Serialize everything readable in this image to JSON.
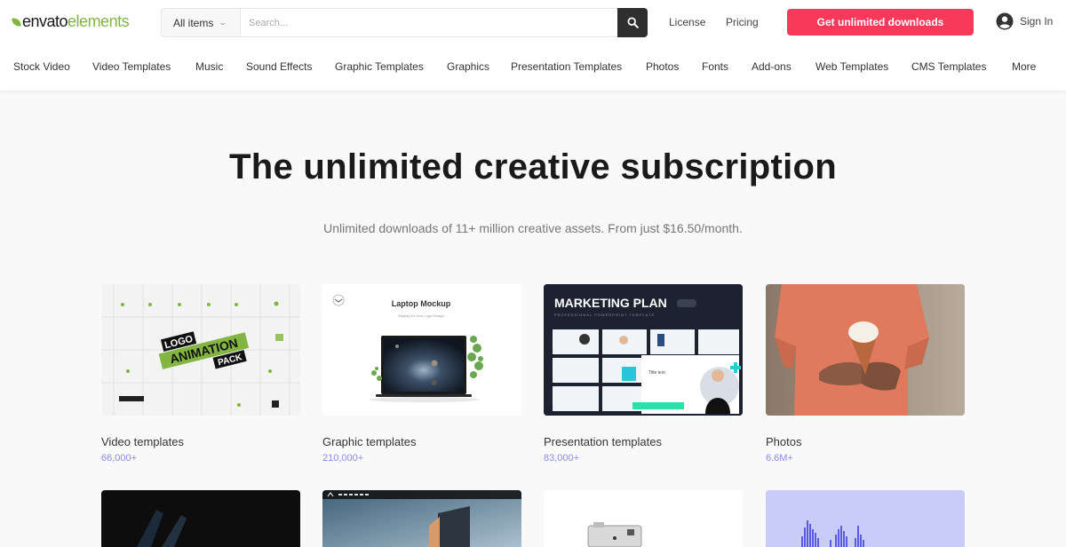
{
  "header": {
    "logo": {
      "brand": "envato",
      "product": "elements"
    },
    "search": {
      "category": "All items",
      "placeholder": "Search..."
    },
    "links": {
      "license": "License",
      "pricing": "Pricing"
    },
    "cta_label": "Get unlimited downloads",
    "signin_label": "Sign In"
  },
  "nav": {
    "items": [
      "Stock Video",
      "Video Templates",
      "Music",
      "Sound Effects",
      "Graphic Templates",
      "Graphics",
      "Presentation Templates",
      "Photos",
      "Fonts",
      "Add-ons",
      "Web Templates",
      "CMS Templates",
      "More"
    ]
  },
  "hero": {
    "title": "The unlimited creative subscription",
    "subtitle": "Unlimited downloads of 11+ million creative assets. From just $16.50/month."
  },
  "categories": [
    {
      "title": "Video templates",
      "count": "66,000+",
      "thumb_text": [
        "LOGO",
        "ANIMATION",
        "PACK"
      ]
    },
    {
      "title": "Graphic templates",
      "count": "210,000+",
      "thumb_text": [
        "Laptop Mockup",
        "Display for Your Logo Design"
      ]
    },
    {
      "title": "Presentation templates",
      "count": "83,000+",
      "thumb_text": [
        "MARKETING PLAN",
        "PROFESSIONAL POWERPOINT TEMPLATE",
        "Title text"
      ]
    },
    {
      "title": "Photos",
      "count": "6.6M+"
    }
  ],
  "colors": {
    "accent": "#f9395c",
    "brand_green": "#82b541",
    "count_color": "#8c8cf0"
  }
}
